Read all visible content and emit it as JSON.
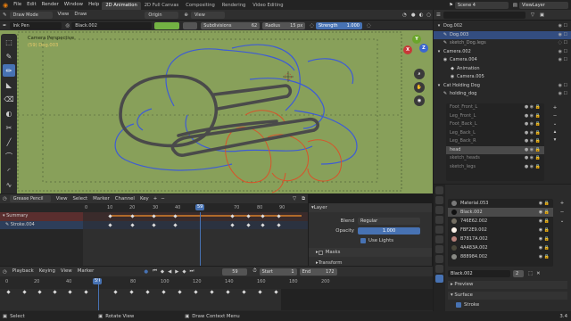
{
  "topbar": {
    "menus": [
      "File",
      "Edit",
      "Render",
      "Window",
      "Help"
    ],
    "workspace_tabs": [
      {
        "label": "2D Animation",
        "active": true
      },
      {
        "label": "2D Full Canvas",
        "active": false
      },
      {
        "label": "Compositing",
        "active": false
      },
      {
        "label": "Rendering",
        "active": false
      },
      {
        "label": "Video Editing",
        "active": false
      }
    ],
    "scene": "Scene 4",
    "view_layer": "ViewLayer"
  },
  "viewport": {
    "mode": "Draw Mode",
    "menus": [
      "View",
      "Draw"
    ],
    "origin": "Origin",
    "view": "View",
    "tool_name": "Ink Pen",
    "material": "Black.002",
    "subdivisions_label": "Subdivisions",
    "subdivisions_value": "62",
    "radius_label": "Radius",
    "radius_value": "15 px",
    "strength_label": "Strength",
    "strength_value": "1.000",
    "camera_label": "Camera Perspective",
    "object_label": "(59) Dog.003",
    "bg_color": "#88a05a"
  },
  "outliner": {
    "rows": [
      {
        "indent": 0,
        "icon": "▾",
        "label": "Dog.002",
        "sel": false
      },
      {
        "indent": 1,
        "icon": "✎",
        "label": "Dog.003",
        "sel": true
      },
      {
        "indent": 1,
        "icon": "✎",
        "label": "sketch_Dog.legs",
        "sel": false
      },
      {
        "indent": 0,
        "icon": "▾",
        "label": "Camera.002",
        "sel": false
      },
      {
        "indent": 1,
        "icon": "◉",
        "label": "Camera.004",
        "sel": false
      },
      {
        "indent": 2,
        "icon": "◆",
        "label": "Animation",
        "sel": false
      },
      {
        "indent": 2,
        "icon": "◉",
        "label": "Camera.005",
        "sel": false
      },
      {
        "indent": 0,
        "icon": "▾",
        "label": "Cat Holding Dog",
        "sel": false
      },
      {
        "indent": 1,
        "icon": "✎",
        "label": "holding_dog",
        "sel": false
      }
    ],
    "layers": [
      "Foot_Front_L",
      "Leg_Front_L",
      "Foot_Back_L",
      "Leg_Back_L",
      "Leg_Back_R",
      "head",
      "sketch_heads",
      "sketch_legs"
    ]
  },
  "properties": {
    "materials": [
      {
        "name": "Material.053",
        "color": "#7a7a7a"
      },
      {
        "name": "Black.002",
        "color": "#111111",
        "sel": true
      },
      {
        "name": "746E62.002",
        "color": "#746e62"
      },
      {
        "name": "FBF2E9.002",
        "color": "#fbf2e9"
      },
      {
        "name": "B7817A.002",
        "color": "#b7817a"
      },
      {
        "name": "4A483A.002",
        "color": "#4a483a"
      },
      {
        "name": "888984.002",
        "color": "#888984"
      }
    ],
    "active_material": "Black.002",
    "active_users": "2",
    "sections": [
      "Preview",
      "Surface",
      "Stroke"
    ]
  },
  "dopesheet": {
    "mode": "Grease Pencil",
    "menus": [
      "View",
      "Select",
      "Marker",
      "Channel",
      "Key"
    ],
    "ruler": [
      "0",
      "10",
      "20",
      "30",
      "40",
      "50",
      "59",
      "70",
      "80",
      "90"
    ],
    "current_frame": "59",
    "channels": [
      {
        "label": "Summary",
        "type": "summary"
      },
      {
        "label": "Stroke.004",
        "type": "object"
      }
    ]
  },
  "layer_panel": {
    "title": "Layer",
    "blend_label": "Blend",
    "blend_value": "Regular",
    "opacity_label": "Opacity",
    "opacity_value": "1.000",
    "use_lights": "Use Lights",
    "masks": "Masks",
    "transform": "Transform"
  },
  "timeline": {
    "menus": [
      "Playback",
      "Keying",
      "View",
      "Marker"
    ],
    "current": "59",
    "start_label": "Start",
    "start": "1",
    "end_label": "End",
    "end": "172",
    "ruler": [
      "0",
      "20",
      "40",
      "59",
      "80",
      "100",
      "120",
      "140",
      "160",
      "180",
      "200"
    ]
  },
  "status": {
    "left": "Select",
    "mid": "Rotate View",
    "right": "Draw Context Menu",
    "version": "3.4"
  }
}
